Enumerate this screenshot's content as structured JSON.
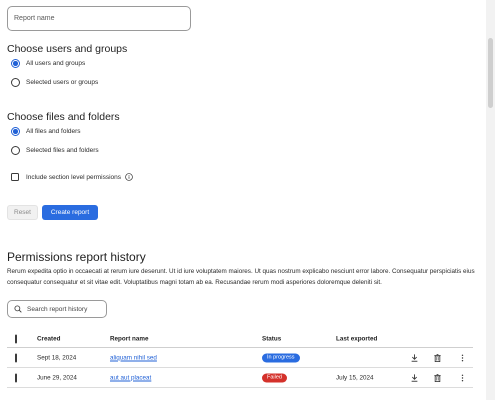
{
  "form": {
    "report_name_placeholder": "Report name"
  },
  "users_section": {
    "title": "Choose users and groups",
    "options": [
      {
        "label": "All users and groups",
        "selected": true
      },
      {
        "label": "Selected users  or groups",
        "selected": false
      }
    ]
  },
  "files_section": {
    "title": "Choose files and folders",
    "options": [
      {
        "label": "All files and folders",
        "selected": true
      },
      {
        "label": "Selected files and folders",
        "selected": false
      }
    ],
    "include_section_label": "Include section level permissions",
    "include_section_checked": false
  },
  "actions": {
    "reset_label": "Reset",
    "create_label": "Create report"
  },
  "history": {
    "title": "Permissions report history",
    "description": "Rerum expedita optio in occaecati at rerum iure deserunt. Ut id iure voluptatem maiores. Ut quas nostrum explicabo nesciunt error labore. Consequatur perspiciatis eius consequatur consequatur et sit vitae edit. Voluptatibus magni totam ab ea. Recusandae rerum modi asperiores doloremque deleniti sit.",
    "search_placeholder": "Search report history",
    "columns": {
      "created": "Created",
      "report_name": "Report name",
      "status": "Status",
      "last_exported": "Last exported"
    },
    "rows": [
      {
        "created": "Sept 18, 2024",
        "report_name": "aliquam nihil sed",
        "status": "In progress",
        "status_color": "#2a6ce0",
        "last_exported": ""
      },
      {
        "created": "June 29, 2024",
        "report_name": "aut aut placeat",
        "status": "Failed",
        "status_color": "#d4312b",
        "last_exported": "July 15, 2024"
      }
    ]
  },
  "colors": {
    "accent": "#2161d6",
    "primary_button": "#2a6ce0",
    "failed": "#d4312b"
  },
  "icons": {
    "info": "info-icon",
    "search": "search-icon",
    "download": "download-icon",
    "delete": "trash-icon",
    "more": "more-vertical-icon"
  }
}
